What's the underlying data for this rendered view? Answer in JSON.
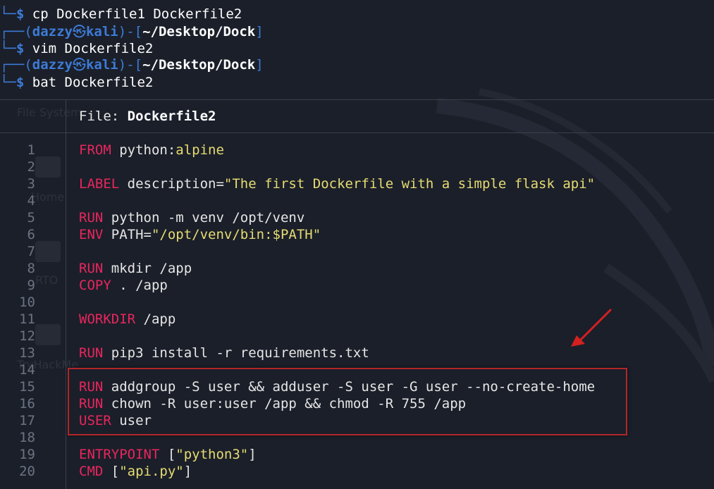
{
  "background_ghosts": {
    "file_system": "File System",
    "home": "Home",
    "rto": "RTO",
    "tryhackme": "TryHackMe"
  },
  "prompt_lines": [
    {
      "type": "cmd",
      "cmd": "cp Dockerfile1 Dockerfile2"
    },
    {
      "type": "prompt",
      "user": "dazzy",
      "host": "kali",
      "path": "~/Desktop/Dock"
    },
    {
      "type": "cmd",
      "cmd": "vim Dockerfile2"
    },
    {
      "type": "prompt",
      "user": "dazzy",
      "host": "kali",
      "path": "~/Desktop/Dock"
    },
    {
      "type": "cmd",
      "cmd": "bat Dockerfile2"
    }
  ],
  "bat": {
    "file_label": "File: ",
    "file_name": "Dockerfile2",
    "lines": [
      {
        "n": "1",
        "parts": [
          {
            "t": "kw",
            "v": "FROM"
          },
          {
            "t": "plain",
            "v": " python:"
          },
          {
            "t": "str",
            "v": "alpine"
          }
        ]
      },
      {
        "n": "2",
        "parts": []
      },
      {
        "n": "3",
        "parts": [
          {
            "t": "kw",
            "v": "LABEL"
          },
          {
            "t": "plain",
            "v": " description="
          },
          {
            "t": "str",
            "v": "\"The first Dockerfile with a simple flask api\""
          }
        ]
      },
      {
        "n": "4",
        "parts": []
      },
      {
        "n": "5",
        "parts": [
          {
            "t": "kw",
            "v": "RUN"
          },
          {
            "t": "plain",
            "v": " python -m venv /opt/venv"
          }
        ]
      },
      {
        "n": "6",
        "parts": [
          {
            "t": "kw",
            "v": "ENV"
          },
          {
            "t": "plain",
            "v": " PATH="
          },
          {
            "t": "str",
            "v": "\"/opt/venv/bin:$PATH\""
          }
        ]
      },
      {
        "n": "7",
        "parts": []
      },
      {
        "n": "8",
        "parts": [
          {
            "t": "kw",
            "v": "RUN"
          },
          {
            "t": "plain",
            "v": " mkdir /app"
          }
        ]
      },
      {
        "n": "9",
        "parts": [
          {
            "t": "kw",
            "v": "COPY"
          },
          {
            "t": "plain",
            "v": " . /app"
          }
        ]
      },
      {
        "n": "10",
        "parts": []
      },
      {
        "n": "11",
        "parts": [
          {
            "t": "kw",
            "v": "WORKDIR"
          },
          {
            "t": "plain",
            "v": " /app"
          }
        ]
      },
      {
        "n": "12",
        "parts": []
      },
      {
        "n": "13",
        "parts": [
          {
            "t": "kw",
            "v": "RUN"
          },
          {
            "t": "plain",
            "v": " pip3 install -r requirements.txt"
          }
        ]
      },
      {
        "n": "14",
        "parts": []
      },
      {
        "n": "15",
        "parts": [
          {
            "t": "kw",
            "v": "RUN"
          },
          {
            "t": "plain",
            "v": " addgroup -S user && adduser -S user -G user --no-create-home"
          }
        ]
      },
      {
        "n": "16",
        "parts": [
          {
            "t": "kw",
            "v": "RUN"
          },
          {
            "t": "plain",
            "v": " chown -R user:user /app && chmod -R 755 /app"
          }
        ]
      },
      {
        "n": "17",
        "parts": [
          {
            "t": "kw",
            "v": "USER"
          },
          {
            "t": "plain",
            "v": " user"
          }
        ]
      },
      {
        "n": "18",
        "parts": []
      },
      {
        "n": "19",
        "parts": [
          {
            "t": "kw",
            "v": "ENTRYPOINT"
          },
          {
            "t": "plain",
            "v": " ["
          },
          {
            "t": "str",
            "v": "\"python3\""
          },
          {
            "t": "plain",
            "v": "]"
          }
        ]
      },
      {
        "n": "20",
        "parts": [
          {
            "t": "kw",
            "v": "CMD"
          },
          {
            "t": "plain",
            "v": " ["
          },
          {
            "t": "str",
            "v": "\"api.py\""
          },
          {
            "t": "plain",
            "v": "]"
          }
        ]
      }
    ]
  },
  "colors": {
    "keyword": "#e8265e",
    "string": "#e6db74",
    "prompt": "#3d7bd7",
    "highlight_box": "#b3262a",
    "arrow": "#d42020"
  }
}
